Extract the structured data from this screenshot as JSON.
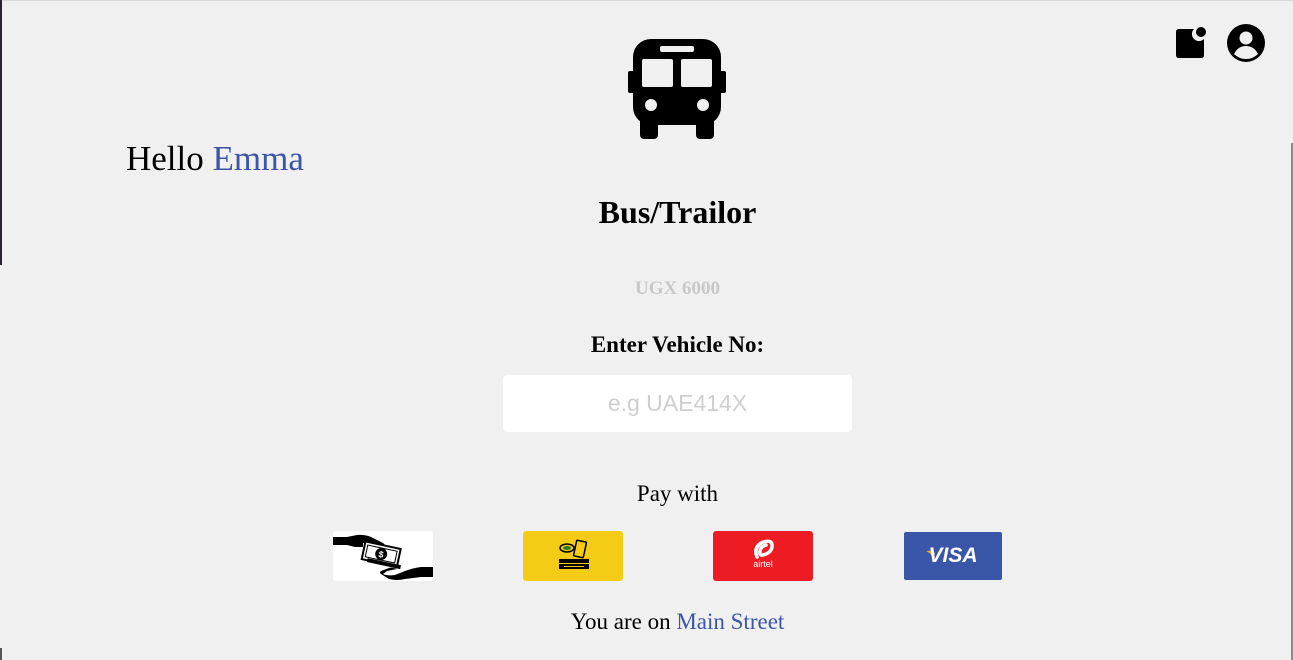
{
  "header": {
    "notification_icon": "notification-icon",
    "profile_icon": "account-circle-icon"
  },
  "vehicle_icon": "bus-icon",
  "greeting": {
    "hello": "Hello",
    "name": "Emma"
  },
  "vehicle": {
    "type": "Bus/Trailor",
    "price": "UGX 6000"
  },
  "form": {
    "label": "Enter Vehicle No:",
    "placeholder": "e.g UAE414X",
    "value": ""
  },
  "payment": {
    "label": "Pay with",
    "methods": [
      {
        "name": "cash",
        "icon": "cash-hand-icon"
      },
      {
        "name": "mtn",
        "icon": "mtn-mobile-money-logo",
        "color": "#f5cc15"
      },
      {
        "name": "airtel",
        "icon": "airtel-logo",
        "label": "airtel",
        "color": "#ed1c24"
      },
      {
        "name": "visa",
        "icon": "visa-logo",
        "label": "VISA",
        "color": "#3a56a8"
      }
    ]
  },
  "location": {
    "prefix": "You are on",
    "street": "Main Street"
  },
  "colors": {
    "accent": "#3c55a6",
    "background": "#f0f0f0",
    "muted": "#c8c8c8"
  }
}
